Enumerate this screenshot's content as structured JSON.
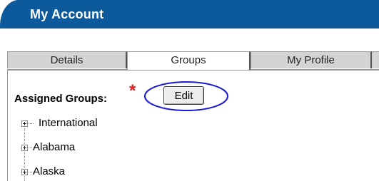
{
  "header": {
    "title": "My Account",
    "accent": "#0c5a9c"
  },
  "tabs": [
    {
      "label": "Details",
      "active": false
    },
    {
      "label": "Groups",
      "active": true
    },
    {
      "label": "My Profile",
      "active": false
    }
  ],
  "groups": {
    "label": "Assigned Groups:",
    "required_marker": "*",
    "edit_label": "Edit",
    "highlight_color": "#1a1ad6",
    "items": [
      {
        "label": "International",
        "icon": "plus-expander-icon"
      },
      {
        "label": "Alabama",
        "icon": "plus-expander-icon"
      },
      {
        "label": "Alaska",
        "icon": "plus-expander-icon"
      }
    ]
  }
}
